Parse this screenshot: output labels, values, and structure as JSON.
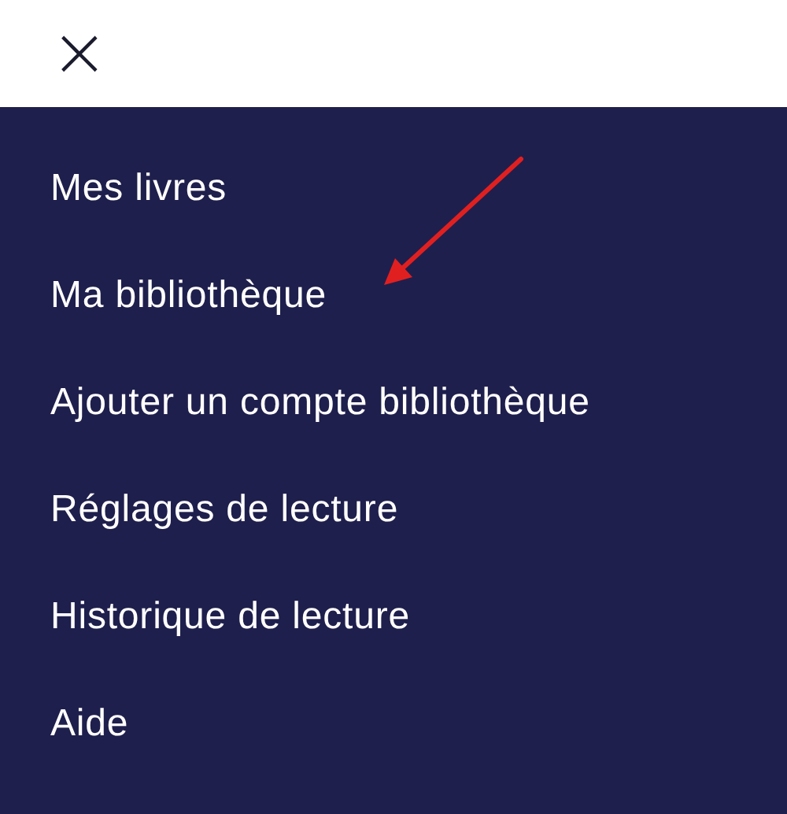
{
  "header": {
    "close_icon": "×"
  },
  "menu": {
    "items": [
      {
        "label": "Mes livres"
      },
      {
        "label": "Ma bibliothèque"
      },
      {
        "label": "Ajouter un compte bibliothèque"
      },
      {
        "label": "Réglages de lecture"
      },
      {
        "label": "Historique de lecture"
      },
      {
        "label": "Aide"
      }
    ]
  }
}
